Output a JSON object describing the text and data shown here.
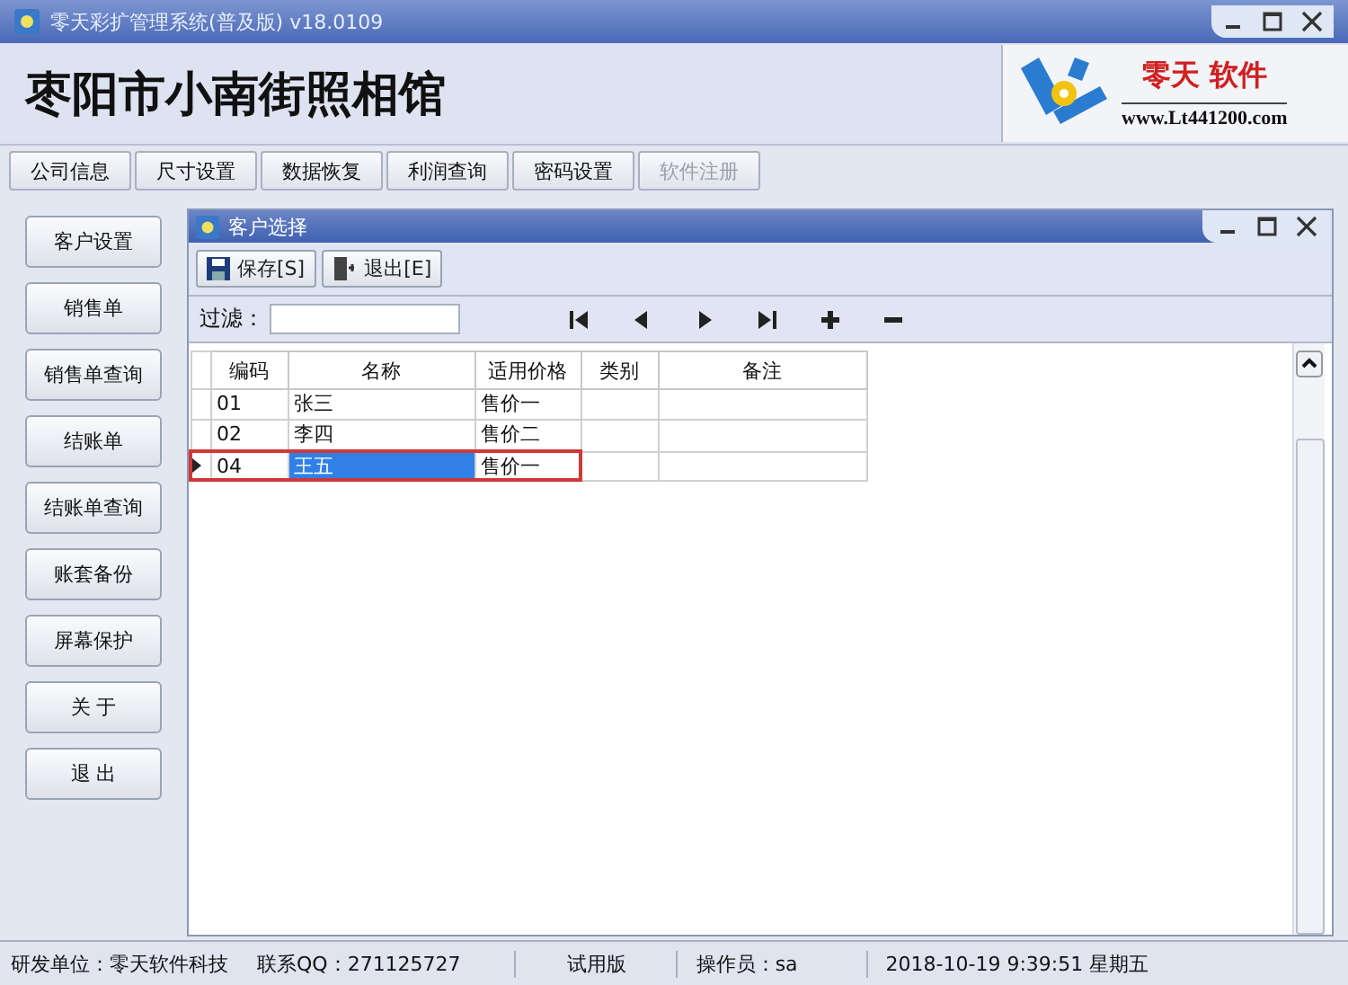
{
  "window": {
    "title": "零天彩扩管理系统(普及版)  v18.0109"
  },
  "header": {
    "shop_name": "枣阳市小南街照相馆",
    "logo_brand": "零天 软件",
    "logo_url": "www.Lt441200.com"
  },
  "tabs": [
    {
      "label": "公司信息",
      "disabled": false
    },
    {
      "label": "尺寸设置",
      "disabled": false
    },
    {
      "label": "数据恢复",
      "disabled": false
    },
    {
      "label": "利润查询",
      "disabled": false
    },
    {
      "label": "密码设置",
      "disabled": false
    },
    {
      "label": "软件注册",
      "disabled": true
    }
  ],
  "sidebar": {
    "items": [
      "客户设置",
      "销售单",
      "销售单查询",
      "结账单",
      "结账单查询",
      "账套备份",
      "屏幕保护",
      "关 于",
      "退 出"
    ]
  },
  "dialog": {
    "title": "客户选择",
    "buttons": [
      {
        "kind": "save",
        "label": "保存[S]"
      },
      {
        "kind": "exit",
        "label": "退出[E]"
      }
    ],
    "filter": {
      "label": "过滤："
    },
    "table": {
      "columns": [
        "编码",
        "名称",
        "适用价格",
        "类别",
        "备注"
      ],
      "rows": [
        {
          "cells": [
            "01",
            "张三",
            "售价一",
            "",
            ""
          ],
          "selected": false
        },
        {
          "cells": [
            "02",
            "李四",
            "售价二",
            "",
            ""
          ],
          "selected": false
        },
        {
          "cells": [
            "04",
            "王五",
            "售价一",
            "",
            ""
          ],
          "selected": true
        }
      ]
    }
  },
  "status_bar": [
    "研发单位：零天软件科技",
    "联系QQ：271125727",
    "试用版",
    "操作员：sa",
    "2018-10-19 9:39:51 星期五"
  ]
}
